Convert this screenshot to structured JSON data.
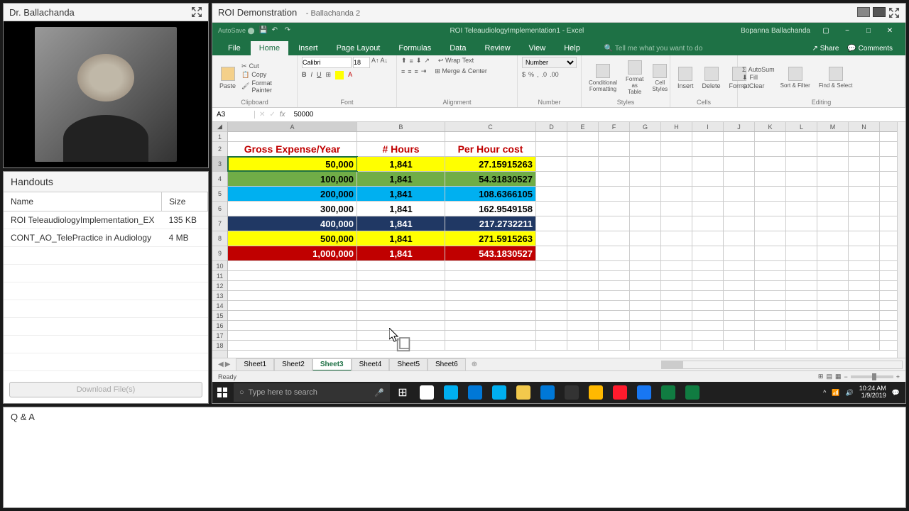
{
  "presenter": {
    "name": "Dr. Ballachanda"
  },
  "main": {
    "title": "ROI Demonstration",
    "subtitle": "- Ballachanda 2"
  },
  "handouts": {
    "title": "Handouts",
    "columns": {
      "name": "Name",
      "size": "Size"
    },
    "files": [
      {
        "name": "ROI TeleaudiologyImplementation_EX",
        "size": "135 KB"
      },
      {
        "name": "CONT_AO_TelePractice in Audiology",
        "size": "4 MB"
      }
    ],
    "download": "Download File(s)"
  },
  "qa": {
    "title": "Q & A"
  },
  "excel": {
    "title": "ROI TeleaudiologyImplementation1 - Excel",
    "user": "Bopanna Ballachanda",
    "tabs": [
      "File",
      "Home",
      "Insert",
      "Page Layout",
      "Formulas",
      "Data",
      "Review",
      "View",
      "Help"
    ],
    "tellme": "Tell me what you want to do",
    "share": "Share",
    "comments": "Comments",
    "ribbon": {
      "clipboard": {
        "label": "Clipboard",
        "cut": "Cut",
        "copy": "Copy",
        "paint": "Format Painter",
        "paste": "Paste"
      },
      "font": {
        "label": "Font",
        "name": "Calibri",
        "size": "18"
      },
      "alignment": {
        "label": "Alignment",
        "wrap": "Wrap Text",
        "merge": "Merge & Center"
      },
      "number": {
        "label": "Number",
        "format": "Number"
      },
      "styles": {
        "label": "Styles",
        "cond": "Conditional Formatting",
        "table": "Format as Table",
        "cell": "Cell Styles"
      },
      "cells": {
        "label": "Cells",
        "insert": "Insert",
        "delete": "Delete",
        "format": "Format"
      },
      "editing": {
        "label": "Editing",
        "autosum": "AutoSum",
        "fill": "Fill",
        "clear": "Clear",
        "sort": "Sort & Filter",
        "find": "Find & Select"
      }
    },
    "namebox": "A3",
    "formula": "50000",
    "columns": [
      "A",
      "B",
      "C",
      "D",
      "E",
      "F",
      "G",
      "H",
      "I",
      "J",
      "K",
      "L",
      "M",
      "N"
    ],
    "headers": {
      "a": "Gross Expense/Year",
      "b": "# Hours",
      "c": "Per Hour cost"
    },
    "rows": [
      {
        "a": "50,000",
        "b": "1,841",
        "c": "27.15915263",
        "cls": "row-yellow"
      },
      {
        "a": "100,000",
        "b": "1,841",
        "c": "54.31830527",
        "cls": "row-green"
      },
      {
        "a": "200,000",
        "b": "1,841",
        "c": "108.6366105",
        "cls": "row-cyan"
      },
      {
        "a": "300,000",
        "b": "1,841",
        "c": "162.9549158",
        "cls": "row-white"
      },
      {
        "a": "400,000",
        "b": "1,841",
        "c": "217.2732211",
        "cls": "row-navy"
      },
      {
        "a": "500,000",
        "b": "1,841",
        "c": "271.5915263",
        "cls": "row-yellow2"
      },
      {
        "a": "1,000,000",
        "b": "1,841",
        "c": "543.1830527",
        "cls": "row-red"
      }
    ],
    "sheets": [
      "Sheet1",
      "Sheet2",
      "Sheet3",
      "Sheet4",
      "Sheet5",
      "Sheet6"
    ],
    "active_sheet": 2,
    "status": "Ready"
  },
  "taskbar": {
    "search_placeholder": "Type here to search",
    "time": "10:24 AM",
    "date": "1/9/2019",
    "apps": [
      {
        "color": "#fff",
        "name": "windows"
      },
      {
        "color": "#00aff0",
        "name": "teamviewer"
      },
      {
        "color": "#0078d7",
        "name": "app2"
      },
      {
        "color": "#00aff0",
        "name": "skype"
      },
      {
        "color": "#f2c94c",
        "name": "chrome"
      },
      {
        "color": "#0078d7",
        "name": "edge"
      },
      {
        "color": "#333",
        "name": "mail"
      },
      {
        "color": "#ffb900",
        "name": "explorer"
      },
      {
        "color": "#ff1b2d",
        "name": "opera"
      },
      {
        "color": "#1877f2",
        "name": "facebook"
      },
      {
        "color": "#107c41",
        "name": "excel1"
      },
      {
        "color": "#107c41",
        "name": "excel2"
      }
    ]
  }
}
